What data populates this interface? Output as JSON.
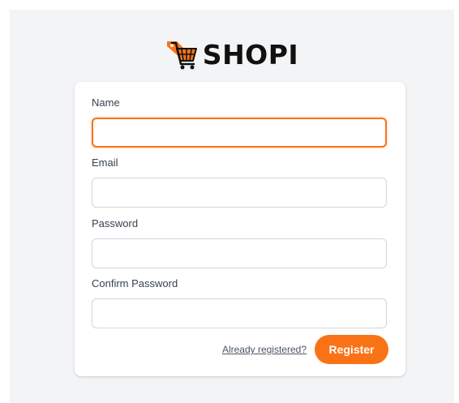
{
  "brand": {
    "name": "SHOPI",
    "icon": "shopping-cart-tag-icon",
    "accent_color": "#f97316",
    "text_color": "#111111"
  },
  "form": {
    "fields": [
      {
        "label": "Name",
        "value": "",
        "placeholder": ""
      },
      {
        "label": "Email",
        "value": "",
        "placeholder": ""
      },
      {
        "label": "Password",
        "value": "",
        "placeholder": ""
      },
      {
        "label": "Confirm Password",
        "value": "",
        "placeholder": ""
      }
    ],
    "login_link": "Already registered?",
    "submit_label": "Register"
  }
}
